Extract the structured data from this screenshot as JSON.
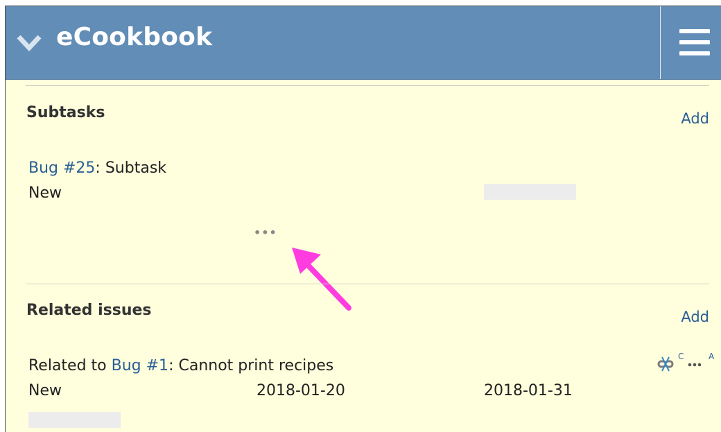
{
  "header": {
    "title": "eCookbook",
    "toggle_icon": "chevron-down-icon",
    "menu_icon": "hamburger-menu-icon",
    "color": "#628db6"
  },
  "subtasks": {
    "title": "Subtasks",
    "add_label": "Add",
    "items": [
      {
        "tracker_link": "Bug #25",
        "separator": ":",
        "subject": " Subtask",
        "status": "New"
      }
    ],
    "more_label": "•••"
  },
  "related_issues": {
    "title": "Related issues",
    "add_label": "Add",
    "items": [
      {
        "relation": "Related to ",
        "tracker_link": "Bug #1",
        "separator": ":",
        "subject": " Cannot print recipes",
        "status": "New",
        "start_date": "2018-01-20",
        "due_date": "2018-01-31",
        "unlink_badge": "C",
        "more_badge": "A"
      }
    ]
  },
  "colors": {
    "background": "#ffffdd",
    "link": "#2a5f96",
    "annotation_arrow": "#ff3ce0"
  }
}
